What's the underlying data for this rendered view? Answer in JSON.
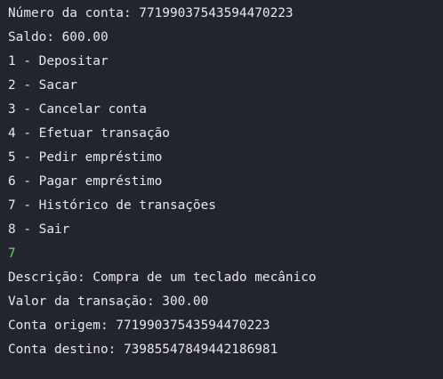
{
  "colors": {
    "background": "#22252d",
    "text": "#e6e8ee",
    "user_input": "#59d86a"
  },
  "terminal": {
    "account_line": "Número da conta: 77199037543594470223",
    "balance_line": "Saldo: 600.00",
    "menu": [
      "1 - Depositar",
      "2 - Sacar",
      "3 - Cancelar conta",
      "4 - Efetuar transação",
      "5 - Pedir empréstimo",
      "6 - Pagar empréstimo",
      "7 - Histórico de transações",
      "8 - Sair"
    ],
    "user_input": "7",
    "history": {
      "description": "Descrição: Compra de um teclado mecânico",
      "amount": "Valor da transação: 300.00",
      "origin_account": "Conta origem: 77199037543594470223",
      "destination_account": "Conta destino: 73985547849442186981"
    }
  }
}
